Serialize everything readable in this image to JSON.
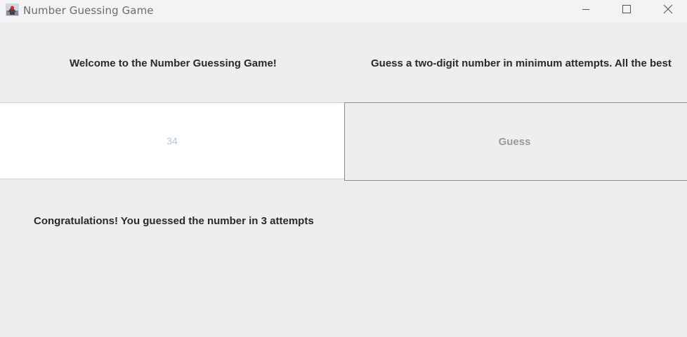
{
  "window": {
    "title": "Number Guessing Game"
  },
  "labels": {
    "welcome": "Welcome to the Number Guessing Game!",
    "instructions": "Guess a two-digit number in minimum attempts. All the best"
  },
  "guess_input": {
    "value": "34"
  },
  "guess_button": {
    "label": "Guess"
  },
  "result": {
    "message": "Congratulations! You guessed the number in 3 attempts"
  },
  "icons": {
    "app": "java-app-icon",
    "minimize": "minimize-icon",
    "maximize": "maximize-icon",
    "close": "close-icon"
  }
}
